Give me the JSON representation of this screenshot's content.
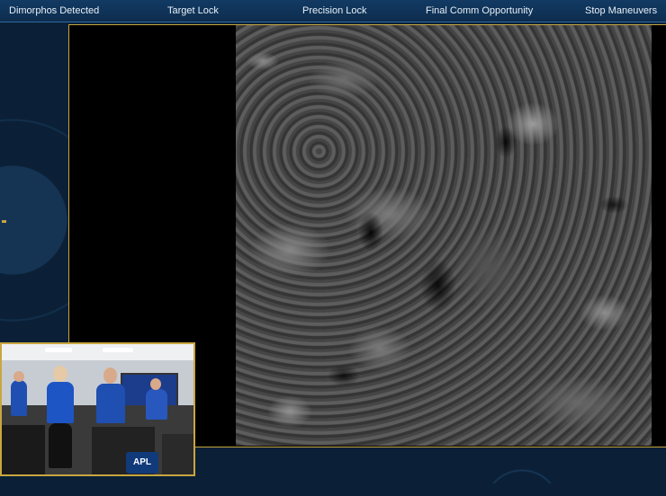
{
  "milestones": [
    "Dimorphos Detected",
    "Target Lock",
    "Precision Lock",
    "Final Comm Opportunity",
    "Stop Maneuvers"
  ],
  "pip": {
    "logo_text": "APL"
  },
  "colors": {
    "frame_border": "#c9a640",
    "background": "#0b2036",
    "topbar": "#123a63"
  }
}
